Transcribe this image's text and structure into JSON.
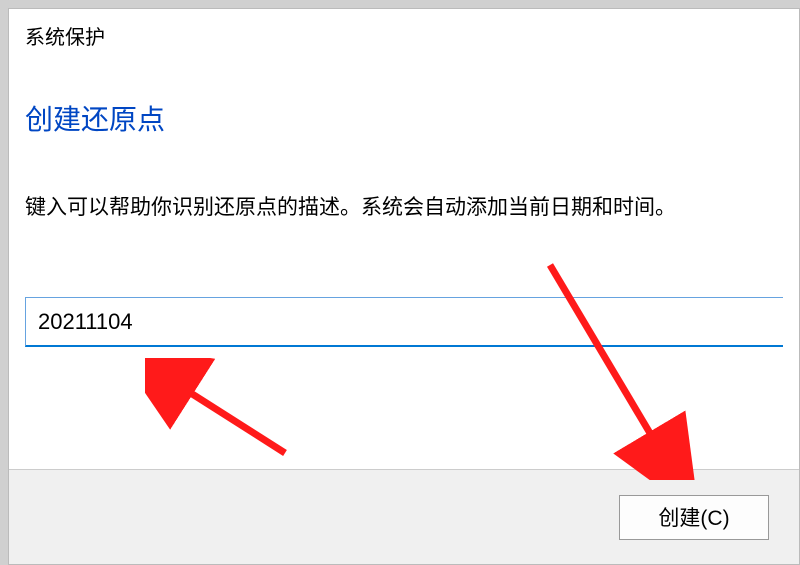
{
  "dialog": {
    "title": "系统保护",
    "heading": "创建还原点",
    "description": "键入可以帮助你识别还原点的描述。系统会自动添加当前日期和时间。",
    "input_value": "20211104",
    "create_button": "创建(C)"
  }
}
